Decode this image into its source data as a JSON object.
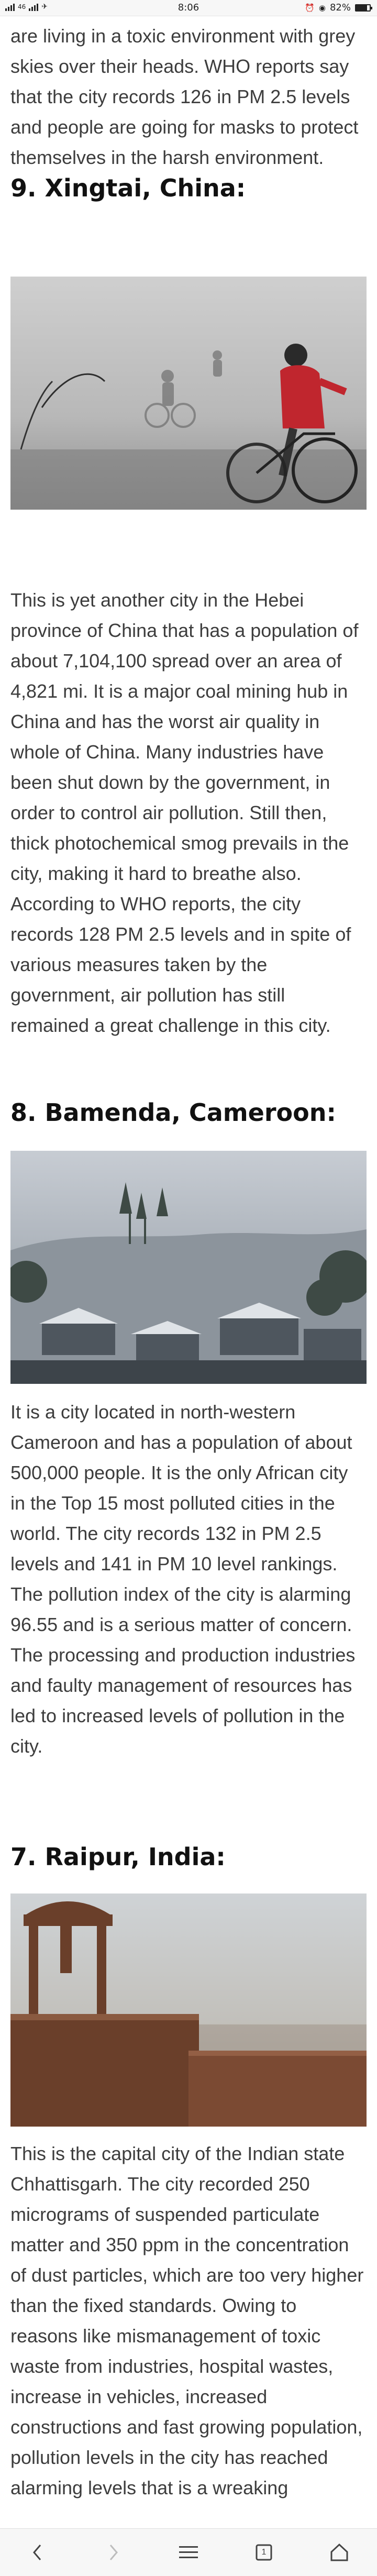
{
  "status_bar": {
    "left_text": "46",
    "time": "8:06",
    "battery_text": "82%",
    "battery_level": 0.82
  },
  "intro_text": "are living in a toxic environment with grey skies over their heads. WHO reports say that the city records 126 in PM 2.5 levels and people are going for masks to protect themselves in the harsh environment.",
  "sections": [
    {
      "heading": "9. Xingtai, China:",
      "body": "This is yet another city in the Hebei province of China that has a population of about 7,104,100 spread over an area of 4,821 mi. It is a major coal mining hub in China and has the worst air quality in whole of China. Many industries have been shut down by the government, in order to control air pollution. Still then, thick photochemical smog prevails in the city, making it hard to breathe also. According to WHO reports, the city records 128 PM 2.5 levels and in spite of various measures taken by the government, air pollution has still remained a great challenge in this city."
    },
    {
      "heading": "8. Bamenda, Cameroon:",
      "body": "It is a city located in north-western Cameroon and has a population of about 500,000 people. It is the only African city in the Top 15 most polluted cities in the world. The city records 132 in PM 2.5 levels and 141 in PM 10 level rankings. The pollution index of the city is alarming 96.55 and is a serious matter of concern. The processing and production industries and faulty management of resources has led to increased levels of pollution in the city."
    },
    {
      "heading": "7. Raipur, India:",
      "body": "This is the capital city of the Indian state Chhattisgarh. The city recorded 250 micrograms of suspended particulate matter and 350 ppm in the concentration of dust particles, which are too very higher than the fixed standards. Owing to reasons like mismanagement of toxic waste from industries, hospital wastes, increase in vehicles, increased constructions and fast growing population, pollution levels in the city has reached alarming levels that is a wreaking"
    }
  ],
  "bottom_nav": {
    "tab_count": "1"
  },
  "colors": {
    "heading": "#111111",
    "body_text": "#3d3d3d",
    "bar_bg": "#f7f7f7"
  }
}
